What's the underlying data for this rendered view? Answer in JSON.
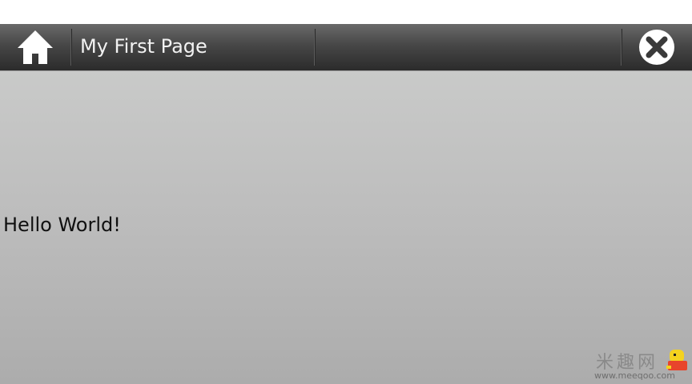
{
  "window": {
    "title": "My First Page"
  },
  "toolbar": {
    "home_icon": "home-icon",
    "close_icon": "close-circle-icon"
  },
  "content": {
    "text": "Hello World!"
  },
  "watermark": {
    "chars": "米趣网",
    "url": "www.meeqoo.com"
  },
  "colors": {
    "titlebar_top": "#6a6a6a",
    "titlebar_bottom": "#2b2b2b",
    "content_top": "#c9cac9",
    "content_bottom": "#acacac",
    "title_text": "#f2f2f2"
  }
}
